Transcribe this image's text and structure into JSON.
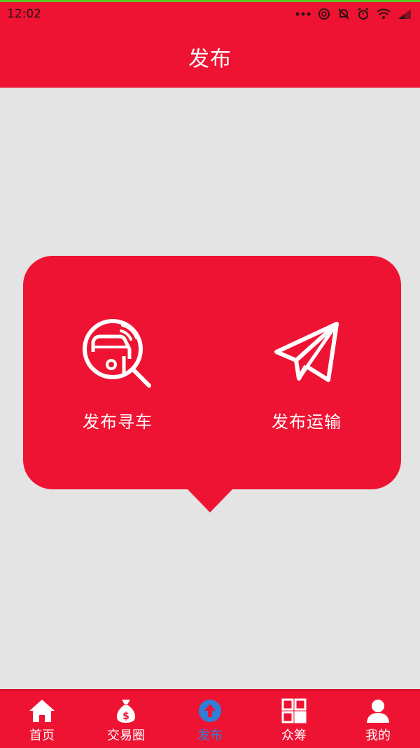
{
  "status_bar": {
    "time": "12:02"
  },
  "header": {
    "title": "发布"
  },
  "popup": {
    "options": [
      {
        "label": "发布寻车",
        "icon": "car-search-icon"
      },
      {
        "label": "发布运输",
        "icon": "paper-plane-icon"
      }
    ]
  },
  "tab_bar": {
    "items": [
      {
        "label": "首页",
        "icon": "home-icon",
        "active": false
      },
      {
        "label": "交易圈",
        "icon": "money-bag-icon",
        "active": false
      },
      {
        "label": "发布",
        "icon": "upload-circle-icon",
        "active": true
      },
      {
        "label": "众筹",
        "icon": "grid-icon",
        "active": false
      },
      {
        "label": "我的",
        "icon": "user-icon",
        "active": false
      }
    ]
  },
  "colors": {
    "primary_red": "#ee1333",
    "background": "#e4e4e4",
    "active_tab": "#2f7fd6",
    "text_white": "#ffffff"
  }
}
